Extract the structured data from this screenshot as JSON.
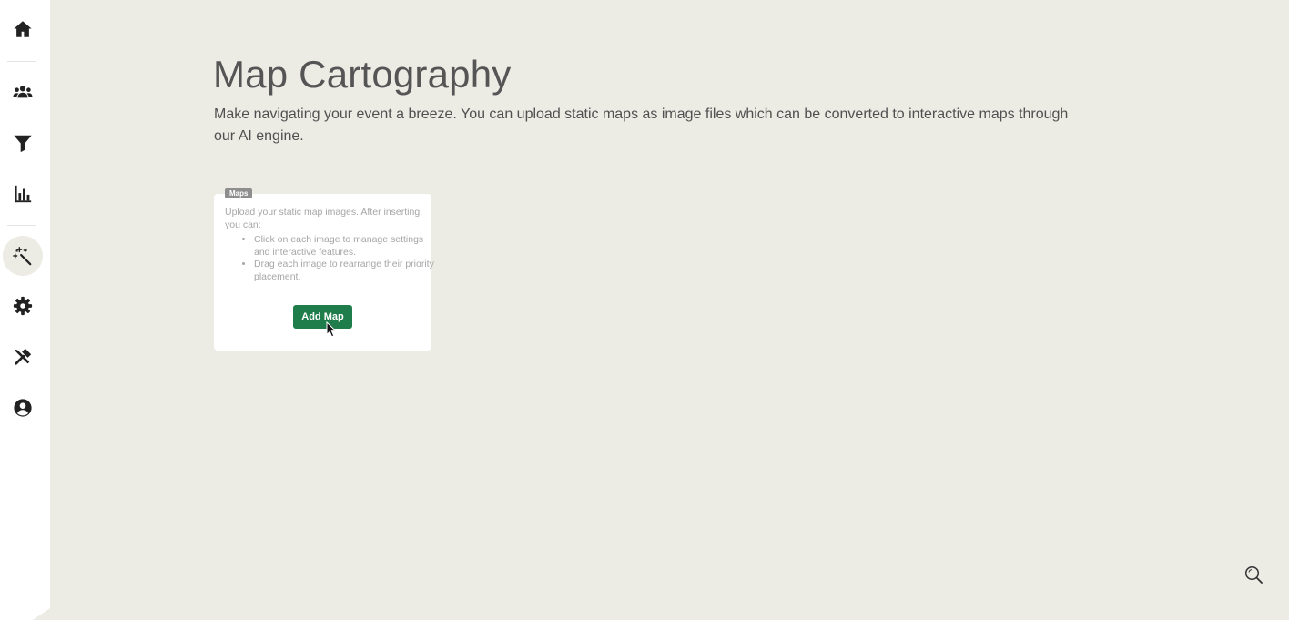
{
  "sidebar": {
    "items": [
      {
        "name": "home",
        "icon": "home-icon"
      },
      {
        "name": "attendees",
        "icon": "users-icon"
      },
      {
        "name": "filter",
        "icon": "filter-icon"
      },
      {
        "name": "analytics",
        "icon": "bar-chart-icon"
      },
      {
        "name": "magic",
        "icon": "magic-wand-icon",
        "active": true
      },
      {
        "name": "settings",
        "icon": "gear-icon"
      },
      {
        "name": "tools",
        "icon": "tools-icon"
      },
      {
        "name": "account",
        "icon": "user-circle-icon"
      }
    ]
  },
  "page": {
    "title": "Map Cartography",
    "subtitle": "Make navigating your event a breeze. You can upload static maps as image files which can be converted to interactive maps through our AI engine."
  },
  "maps_card": {
    "tag": "Maps",
    "intro": "Upload your static map images. After inserting, you can:",
    "bullets": [
      "Click on each image to manage settings and interactive features.",
      "Drag each image to rearrange their priority placement."
    ],
    "add_button_label": "Add Map"
  },
  "floating": {
    "search_icon": "search-icon"
  },
  "colors": {
    "background": "#ecebe4",
    "sidebar": "#ffffff",
    "primary_button": "#1f7d4b",
    "tag": "#8e8e8e"
  }
}
